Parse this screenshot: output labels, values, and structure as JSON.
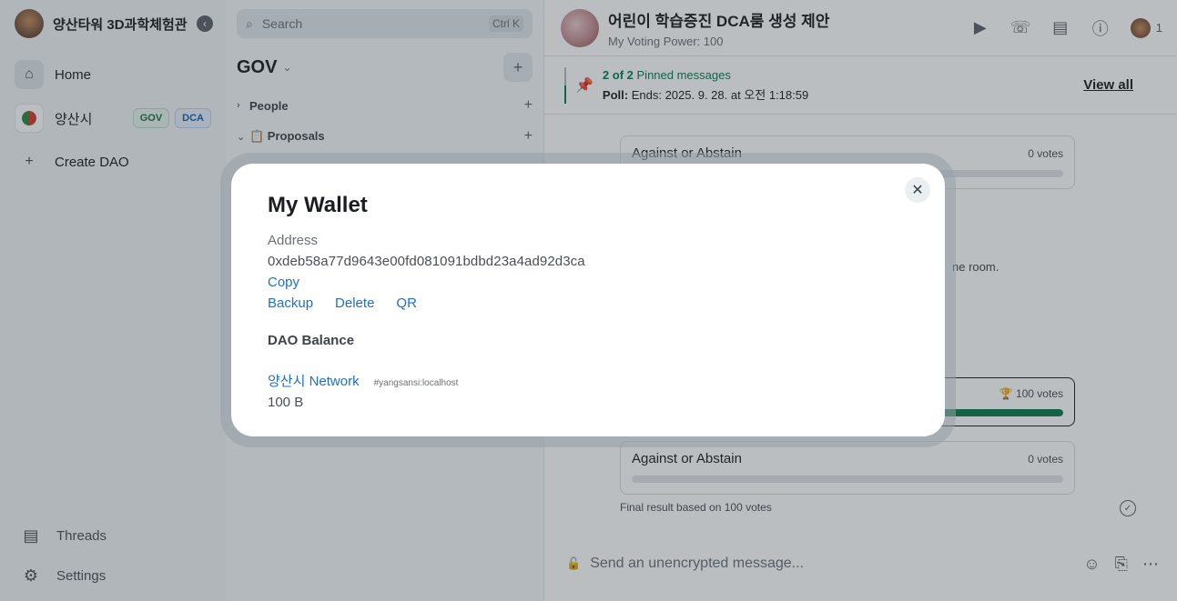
{
  "rail": {
    "space_title": "양산타워 3D과학체험관",
    "collapse_icon": "‹",
    "home_label": "Home",
    "dao_name": "양산시",
    "tag_gov": "GOV",
    "tag_dca": "DCA",
    "create_dao_label": "Create DAO",
    "threads_label": "Threads",
    "settings_label": "Settings"
  },
  "roomlist": {
    "search_placeholder": "Search",
    "search_shortcut": "Ctrl K",
    "space_name": "GOV",
    "sections": [
      {
        "label": "People"
      },
      {
        "label": "📋 Proposals"
      }
    ]
  },
  "room": {
    "title": "어린이 학습증진 DCA룸 생성 제안",
    "subtitle": "My Voting Power: 100",
    "member_count": "1",
    "pinned_count": "2 of 2",
    "pinned_label": "Pinned messages",
    "pinned_poll_prefix": "Poll:",
    "pinned_poll_text": "Ends: 2025. 9. 28. at 오전 1:18:59",
    "view_all": "View all",
    "partial_text": "ne room.",
    "poll_top_option": "Against or Abstain",
    "poll_top_votes": "0 votes",
    "poll_win_votes": "100 votes",
    "poll_bottom_option": "Against or Abstain",
    "poll_bottom_votes": "0 votes",
    "final_result": "Final result based on 100 votes",
    "composer_placeholder": "Send an unencrypted message..."
  },
  "modal": {
    "title": "My Wallet",
    "address_label": "Address",
    "address": "0xdeb58a77d9643e00fd081091bdbd23a4ad92d3ca",
    "copy": "Copy",
    "backup": "Backup",
    "delete": "Delete",
    "qr": "QR",
    "dao_balance_title": "DAO Balance",
    "network_name": "양산시 Network",
    "network_id": "#yangsansi:localhost",
    "balance": "100 B",
    "close_icon": "✕"
  },
  "colors": {
    "accent_green": "#0b7a4c",
    "link_blue": "#1f6fc4"
  }
}
